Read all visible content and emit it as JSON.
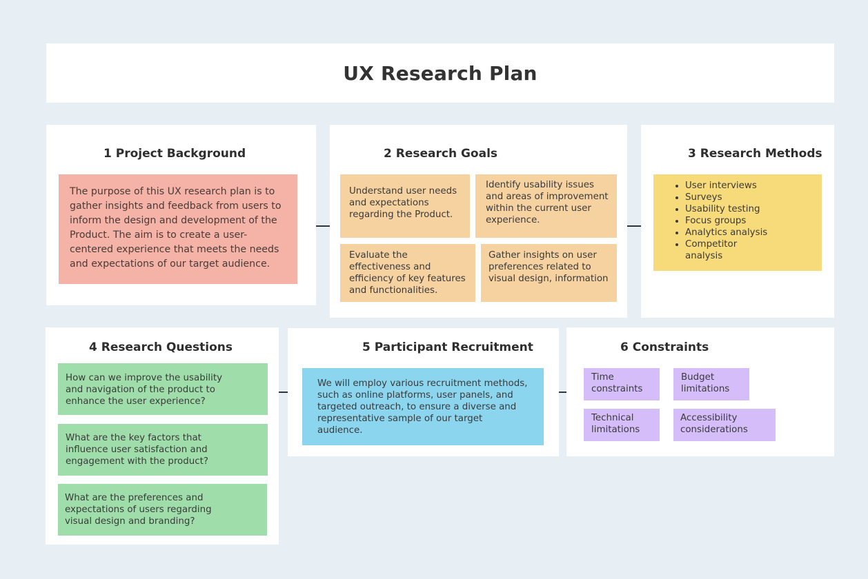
{
  "page": {
    "title": "UX Research Plan",
    "background_color": "#e7eff5"
  },
  "sections": {
    "project_background": {
      "heading": "1 Project Background",
      "note_color": "#f4b3a6",
      "text": "The purpose of this UX research plan is to gather insights and feedback from users to inform the design and development of the Product. The aim is to create a user-centered experience that meets the needs and expectations of our target audience."
    },
    "research_goals": {
      "heading": "2 Research Goals",
      "note_color": "#f6d2a1",
      "goals": [
        "Understand user needs and expectations regarding the Product.",
        "Identify usability issues and areas of improvement within the current user experience.",
        "Evaluate the effectiveness and efficiency of key features and functionalities.",
        "Gather insights on user preferences related to visual design, information"
      ]
    },
    "research_methods": {
      "heading": "3 Research Methods",
      "note_color": "#f7da7a",
      "methods": [
        "User interviews",
        "Surveys",
        "Usability testing",
        "Focus groups",
        "Analytics analysis",
        "Competitor analysis"
      ]
    },
    "research_questions": {
      "heading": "4 Research Questions",
      "note_color": "#9fdeaa",
      "questions": [
        "How can we improve the usability and navigation of the product to enhance the user experience?",
        "What are the key factors that influence user satisfaction and engagement with the product?",
        "What are the preferences and expectations of users regarding visual design and branding?"
      ]
    },
    "participant_recruitment": {
      "heading": "5 Participant Recruitment",
      "note_color": "#8cd5ee",
      "text": "We will employ various recruitment methods, such as online platforms, user panels, and targeted outreach, to ensure a diverse and representative sample of our target audience."
    },
    "constraints": {
      "heading": "6 Constraints",
      "note_color": "#d5bdfa",
      "items": [
        "Time constraints",
        "Budget limitations",
        "Technical limitations",
        "Accessibility considerations"
      ]
    }
  }
}
